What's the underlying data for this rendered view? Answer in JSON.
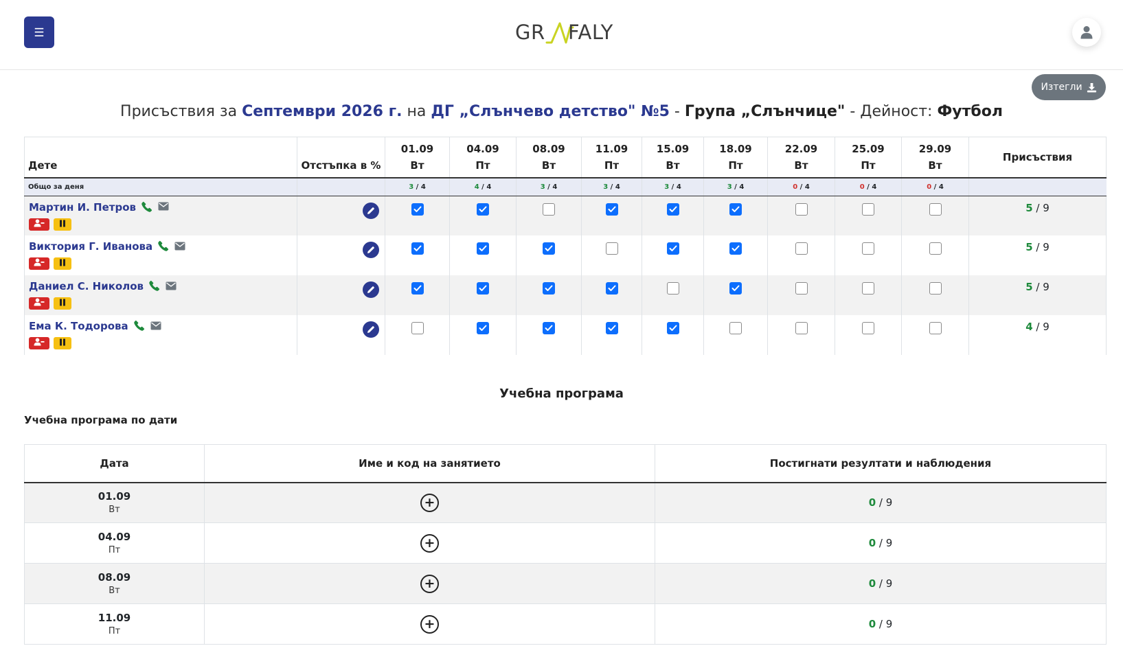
{
  "header": {
    "logo_left": "GR",
    "logo_right": "FALY"
  },
  "download": {
    "label": "Изтегли"
  },
  "title": {
    "p1": "Присъствия за ",
    "month": "Септември 2026 г.",
    "p2": " на ",
    "kindergarten": "ДГ „Слънчево детство\" №5",
    "p3": " - ",
    "group": "Група „Слънчице\"",
    "p4": " - Дейност: ",
    "activity": "Футбол"
  },
  "attendance": {
    "col_child": "Дете",
    "col_discount": "Отстъпка в %",
    "col_total": "Присъствия",
    "sum_label": "Общо за деня",
    "dates": [
      {
        "date": "01.09",
        "day": "Вт",
        "present": "3",
        "total": "4",
        "color": "#1e8a3c"
      },
      {
        "date": "04.09",
        "day": "Пт",
        "present": "4",
        "total": "4",
        "color": "#1e8a3c"
      },
      {
        "date": "08.09",
        "day": "Вт",
        "present": "3",
        "total": "4",
        "color": "#1e8a3c"
      },
      {
        "date": "11.09",
        "day": "Пт",
        "present": "3",
        "total": "4",
        "color": "#1e8a3c"
      },
      {
        "date": "15.09",
        "day": "Вт",
        "present": "3",
        "total": "4",
        "color": "#1e8a3c"
      },
      {
        "date": "18.09",
        "day": "Пт",
        "present": "3",
        "total": "4",
        "color": "#1e8a3c"
      },
      {
        "date": "22.09",
        "day": "Вт",
        "present": "0",
        "total": "4",
        "color": "#d0312d"
      },
      {
        "date": "25.09",
        "day": "Пт",
        "present": "0",
        "total": "4",
        "color": "#d0312d"
      },
      {
        "date": "29.09",
        "day": "Вт",
        "present": "0",
        "total": "4",
        "color": "#d0312d"
      }
    ],
    "children": [
      {
        "name": "Мартин И. Петров",
        "checks": [
          true,
          true,
          false,
          true,
          true,
          true,
          false,
          false,
          false
        ],
        "present": "5",
        "total": "9"
      },
      {
        "name": "Виктория Г. Иванова",
        "checks": [
          true,
          true,
          true,
          false,
          true,
          true,
          false,
          false,
          false
        ],
        "present": "5",
        "total": "9"
      },
      {
        "name": "Даниел С. Николов",
        "checks": [
          true,
          true,
          true,
          true,
          false,
          true,
          false,
          false,
          false
        ],
        "present": "5",
        "total": "9"
      },
      {
        "name": "Ема К. Тодорова",
        "checks": [
          false,
          true,
          true,
          true,
          true,
          false,
          false,
          false,
          false
        ],
        "present": "4",
        "total": "9"
      }
    ],
    "icons": {
      "phone": "phone-icon",
      "mail": "mail-icon",
      "edit": "pencil-icon",
      "remove": "user-minus-icon",
      "pause": "pause-icon"
    }
  },
  "program": {
    "title": "Учебна програма",
    "subtitle": "Учебна програма по дати",
    "col_date": "Дата",
    "col_name": "Име и код на занятието",
    "col_results": "Постигнати резултати и наблюдения",
    "rows": [
      {
        "date": "01.09",
        "day": "Вт",
        "done": "0",
        "total": "9"
      },
      {
        "date": "04.09",
        "day": "Пт",
        "done": "0",
        "total": "9"
      },
      {
        "date": "08.09",
        "day": "Вт",
        "done": "0",
        "total": "9"
      },
      {
        "date": "11.09",
        "day": "Пт",
        "done": "0",
        "total": "9"
      }
    ]
  }
}
